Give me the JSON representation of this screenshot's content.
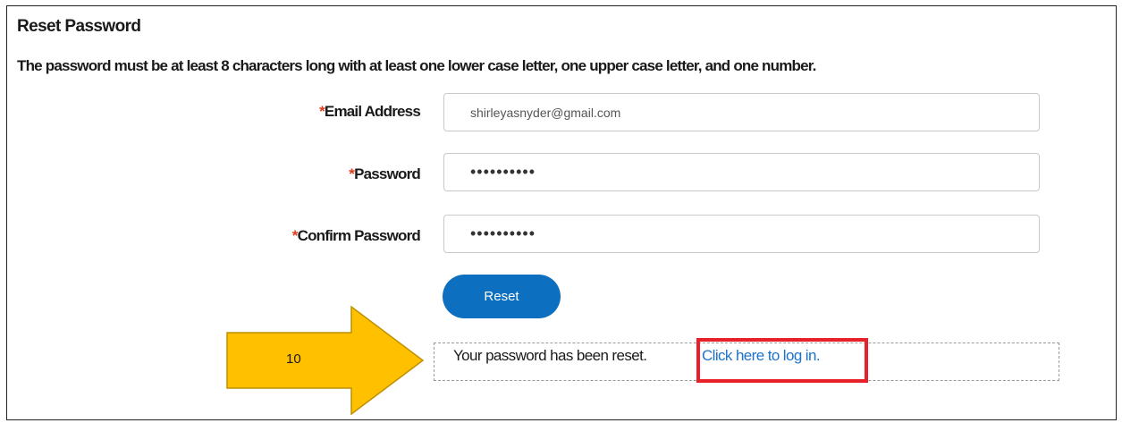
{
  "page": {
    "title": "Reset Password",
    "description": "The password must be at least 8 characters long with at least one lower case letter, one upper case letter, and one number."
  },
  "form": {
    "required_marker": "*",
    "email": {
      "label": "Email Address",
      "value": "shirleyasnyder@gmail.com"
    },
    "password": {
      "label": "Password",
      "value": "••••••••••"
    },
    "confirm_password": {
      "label": "Confirm Password",
      "value": "••••••••••"
    },
    "reset_label": "Reset"
  },
  "result": {
    "message": "Your password has been reset.",
    "login_link": "Click here to log in."
  },
  "annotation": {
    "step_number": "10",
    "arrow_color": "#ffc000",
    "highlight_color": "#e8202a"
  },
  "colors": {
    "button": "#0d6fbf",
    "link": "#1e73c8",
    "required": "#e03a1a"
  }
}
